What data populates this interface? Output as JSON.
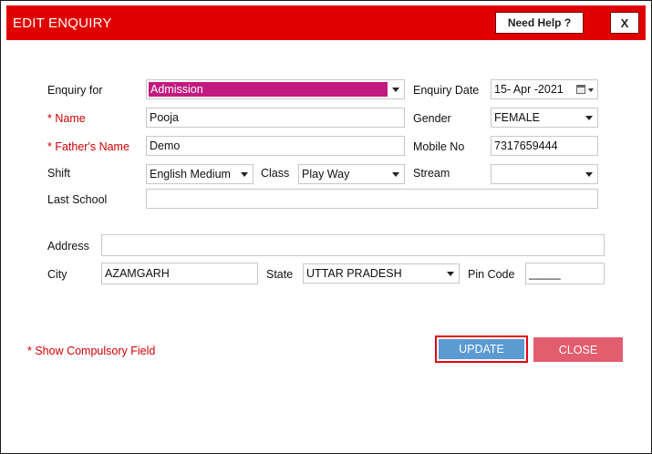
{
  "window": {
    "title": "EDIT ENQUIRY",
    "help_label": "Need Help ?",
    "close_label": "X"
  },
  "form": {
    "enquiry_for": {
      "label": "Enquiry for",
      "value": "Admission"
    },
    "enquiry_date": {
      "label": "Enquiry Date",
      "value": "15- Apr -2021"
    },
    "name": {
      "label": "* Name",
      "value": "Pooja"
    },
    "gender": {
      "label": "Gender",
      "value": "FEMALE"
    },
    "father_name": {
      "label": "* Father's Name",
      "value": "Demo"
    },
    "mobile": {
      "label": "Mobile  No",
      "value": "7317659444"
    },
    "shift": {
      "label": "Shift",
      "value": "English Medium"
    },
    "class": {
      "label": "Class",
      "value": "Play Way"
    },
    "stream": {
      "label": "Stream",
      "value": ""
    },
    "last_school": {
      "label": "Last School",
      "value": ""
    },
    "address": {
      "label": "Address",
      "value": ""
    },
    "city": {
      "label": "City",
      "value": "AZAMGARH"
    },
    "state": {
      "label": "State",
      "value": "UTTAR PRADESH"
    },
    "pin_code": {
      "label": "Pin Code",
      "value": "_____"
    }
  },
  "footer": {
    "note": "* Show Compulsory Field",
    "update_label": "UPDATE",
    "close_label": "CLOSE"
  },
  "colors": {
    "title_bar": "#e00000",
    "selection": "#c21a7e",
    "update_button": "#5b9bd1",
    "close_button": "#e25e6e",
    "required_label": "#d00000"
  }
}
